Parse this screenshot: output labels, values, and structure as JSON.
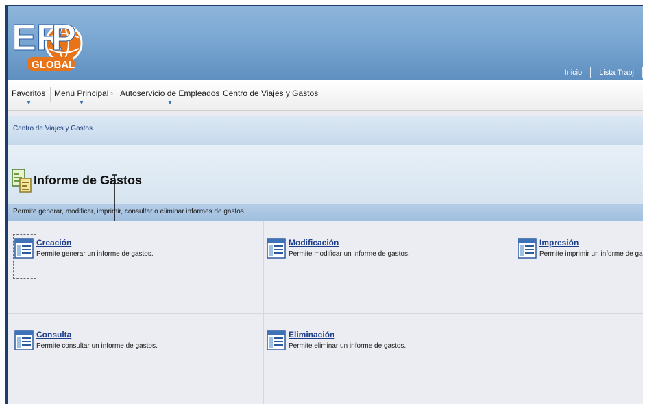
{
  "header": {
    "logo_text": "ERP",
    "logo_sub": "GLOBAL",
    "links": [
      "Inicio",
      "Lista Trabj"
    ]
  },
  "nav": {
    "items": [
      {
        "label": "Favoritos"
      },
      {
        "label": "Menú Principal"
      },
      {
        "label": "Autoservicio de Empleados"
      },
      {
        "label": "Centro de Viajes y Gastos"
      }
    ],
    "separator": "›"
  },
  "breadcrumb": "Centro de Viajes y Gastos",
  "page": {
    "title": "Informe de Gastos",
    "description": "Permite generar, modificar, imprimir, consultar o eliminar informes de gastos."
  },
  "cards": [
    {
      "title": "Creación",
      "description": "Permite generar un informe de gastos."
    },
    {
      "title": "Modificación",
      "description": "Permite modificar un informe de gastos."
    },
    {
      "title": "Impresión",
      "description": "Permite imprimir un informe de gastos"
    },
    {
      "title": "Consulta",
      "description": "Permite consultar un informe de gastos."
    },
    {
      "title": "Eliminación",
      "description": "Permite eliminar un informe de gastos."
    }
  ],
  "colors": {
    "header_blue": "#7aa7d2",
    "logo_orange": "#e8741a",
    "link_blue": "#1d3e8a",
    "desc_bar": "#9fbfdf"
  },
  "icons": {
    "logo": "erp-global-logo",
    "page": "report-document-icon",
    "card": "list-document-icon"
  }
}
